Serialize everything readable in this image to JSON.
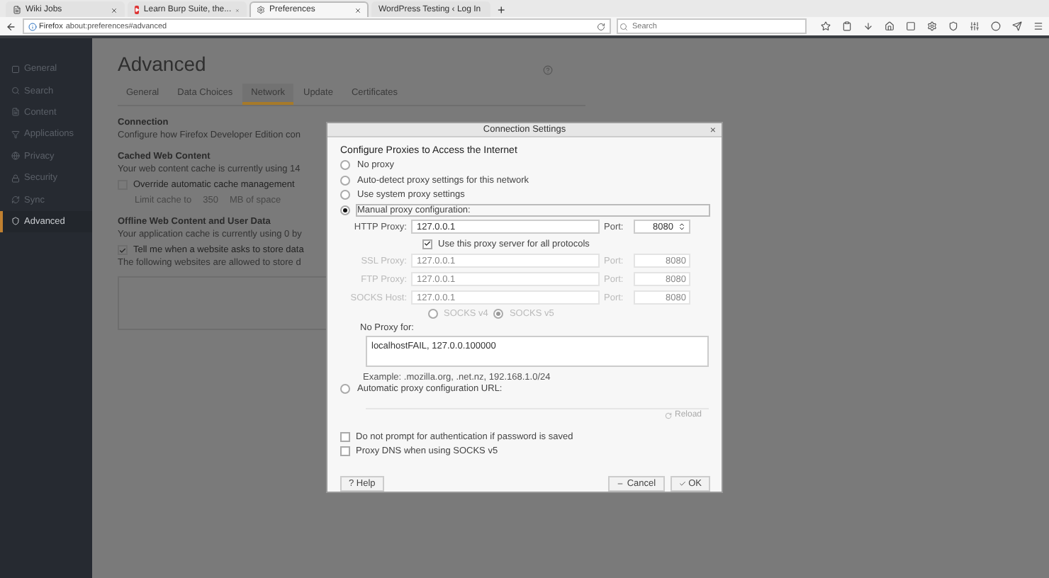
{
  "browser_tabs": [
    {
      "title": "Wiki Jobs",
      "kind": "doc",
      "selected": false
    },
    {
      "title": "Learn Burp Suite, the...",
      "kind": "video",
      "selected": false
    },
    {
      "title": "Preferences",
      "kind": "gear",
      "selected": true
    },
    {
      "title": "WordPress Testing ‹ Log In",
      "kind": "none",
      "selected": false
    }
  ],
  "new_tab": "+",
  "address_bar": {
    "identity": "Firefox",
    "url": "about:preferences#advanced"
  },
  "search": {
    "placeholder": "Search"
  },
  "sidebar": {
    "items": [
      {
        "label": "General",
        "selected": false
      },
      {
        "label": "Search",
        "selected": false
      },
      {
        "label": "Content",
        "selected": false
      },
      {
        "label": "Applications",
        "selected": false
      },
      {
        "label": "Privacy",
        "selected": false
      },
      {
        "label": "Security",
        "selected": false
      },
      {
        "label": "Sync",
        "selected": false
      },
      {
        "label": "Advanced",
        "selected": true
      }
    ]
  },
  "page": {
    "title": "Advanced",
    "tabs": [
      {
        "label": "General",
        "selected": false
      },
      {
        "label": "Data Choices",
        "selected": false
      },
      {
        "label": "Network",
        "selected": true
      },
      {
        "label": "Update",
        "selected": false
      },
      {
        "label": "Certificates",
        "selected": false
      }
    ],
    "connection": {
      "heading": "Connection",
      "text": "Configure how Firefox Developer Edition con"
    },
    "cache": {
      "heading": "Cached Web Content",
      "text": "Your web content cache is currently using 14",
      "override": {
        "label": "Override automatic cache management",
        "checked": false
      },
      "limit": {
        "label": "Limit cache to",
        "value": "350",
        "unit": "MB of space",
        "disabled": true
      }
    },
    "offline": {
      "heading": "Offline Web Content and User Data",
      "text": "Your application cache is currently using 0 by",
      "notify": {
        "label": "Tell me when a website asks to store data",
        "checked": true
      },
      "allowed_text": "The following websites are allowed to store d"
    }
  },
  "dialog": {
    "title": "Connection Settings",
    "close": "×",
    "heading": "Configure Proxies to Access the Internet",
    "modes": [
      {
        "label": "No proxy",
        "kind": "plain",
        "selected": false
      },
      {
        "label": "Auto-detect proxy settings for this network",
        "kind": "plain",
        "selected": false
      },
      {
        "label": "Use system proxy settings",
        "kind": "plain",
        "selected": false
      },
      {
        "label": "Manual proxy configuration:",
        "kind": "manual",
        "selected": true
      },
      {
        "label": "Automatic proxy configuration URL:",
        "kind": "pac",
        "selected": false
      }
    ],
    "proxies": [
      {
        "label": "HTTP Proxy:",
        "value": "127.0.0.1",
        "port_label": "Port:",
        "port": "8080",
        "disabled": false
      },
      {
        "label": "SSL Proxy:",
        "value": "127.0.0.1",
        "port_label": "Port:",
        "port": "8080",
        "disabled": true
      },
      {
        "label": "FTP Proxy:",
        "value": "127.0.0.1",
        "port_label": "Port:",
        "port": "8080",
        "disabled": true
      },
      {
        "label": "SOCKS Host:",
        "value": "127.0.0.1",
        "port_label": "Port:",
        "port": "8080",
        "disabled": true
      }
    ],
    "share_all": {
      "label": "Use this proxy server for all protocols",
      "checked": true
    },
    "socks_versions": [
      {
        "label": "SOCKS v4",
        "selected": false
      },
      {
        "label": "SOCKS v5",
        "selected": true
      }
    ],
    "no_proxy": {
      "label": "No Proxy for:",
      "value": "localhostFAIL, 127.0.0.100000"
    },
    "example": "Example: .mozilla.org, .net.nz, 192.168.1.0/24",
    "reload": {
      "label": "Reload",
      "disabled": true
    },
    "options": [
      {
        "label": "Do not prompt for authentication if password is saved",
        "checked": false
      },
      {
        "label": "Proxy DNS when using SOCKS v5",
        "checked": false
      }
    ],
    "buttons": [
      {
        "label": "? Help",
        "kind": "help"
      },
      {
        "label": "Cancel",
        "kind": "cancel"
      },
      {
        "label": "OK",
        "kind": "ok"
      }
    ]
  }
}
